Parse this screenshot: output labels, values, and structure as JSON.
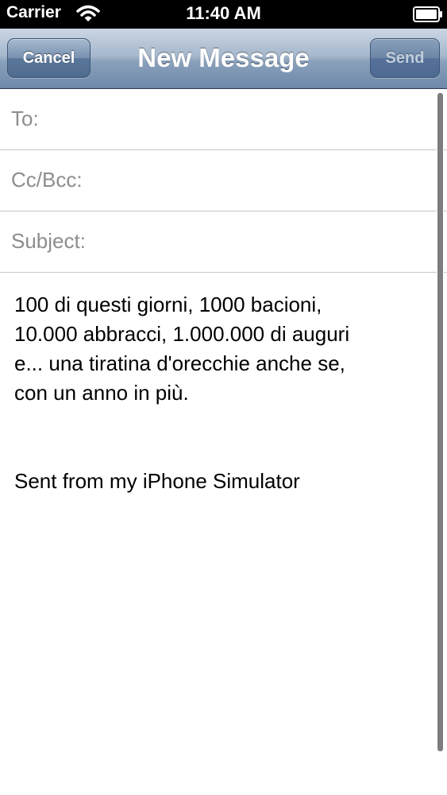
{
  "status_bar": {
    "carrier": "Carrier",
    "time": "11:40 AM",
    "wifi_icon": "wifi-icon",
    "battery_icon": "battery-icon"
  },
  "nav": {
    "title": "New Message",
    "cancel_label": "Cancel",
    "send_label": "Send"
  },
  "fields": {
    "to_label": "To:",
    "cc_label": "Cc/Bcc:",
    "subject_label": "Subject:"
  },
  "body": {
    "lines": [
      "100 di questi giorni, 1000 bacioni,",
      "10.000 abbracci, 1.000.000 di auguri",
      "e... una tiratina d'orecchie anche se,",
      "con un anno in più."
    ],
    "signature": "Sent from my iPhone Simulator"
  },
  "colors": {
    "nav_bar": "#8aa1bb",
    "placeholder_label": "#8d8d8d",
    "separator": "#c6c6c6"
  }
}
